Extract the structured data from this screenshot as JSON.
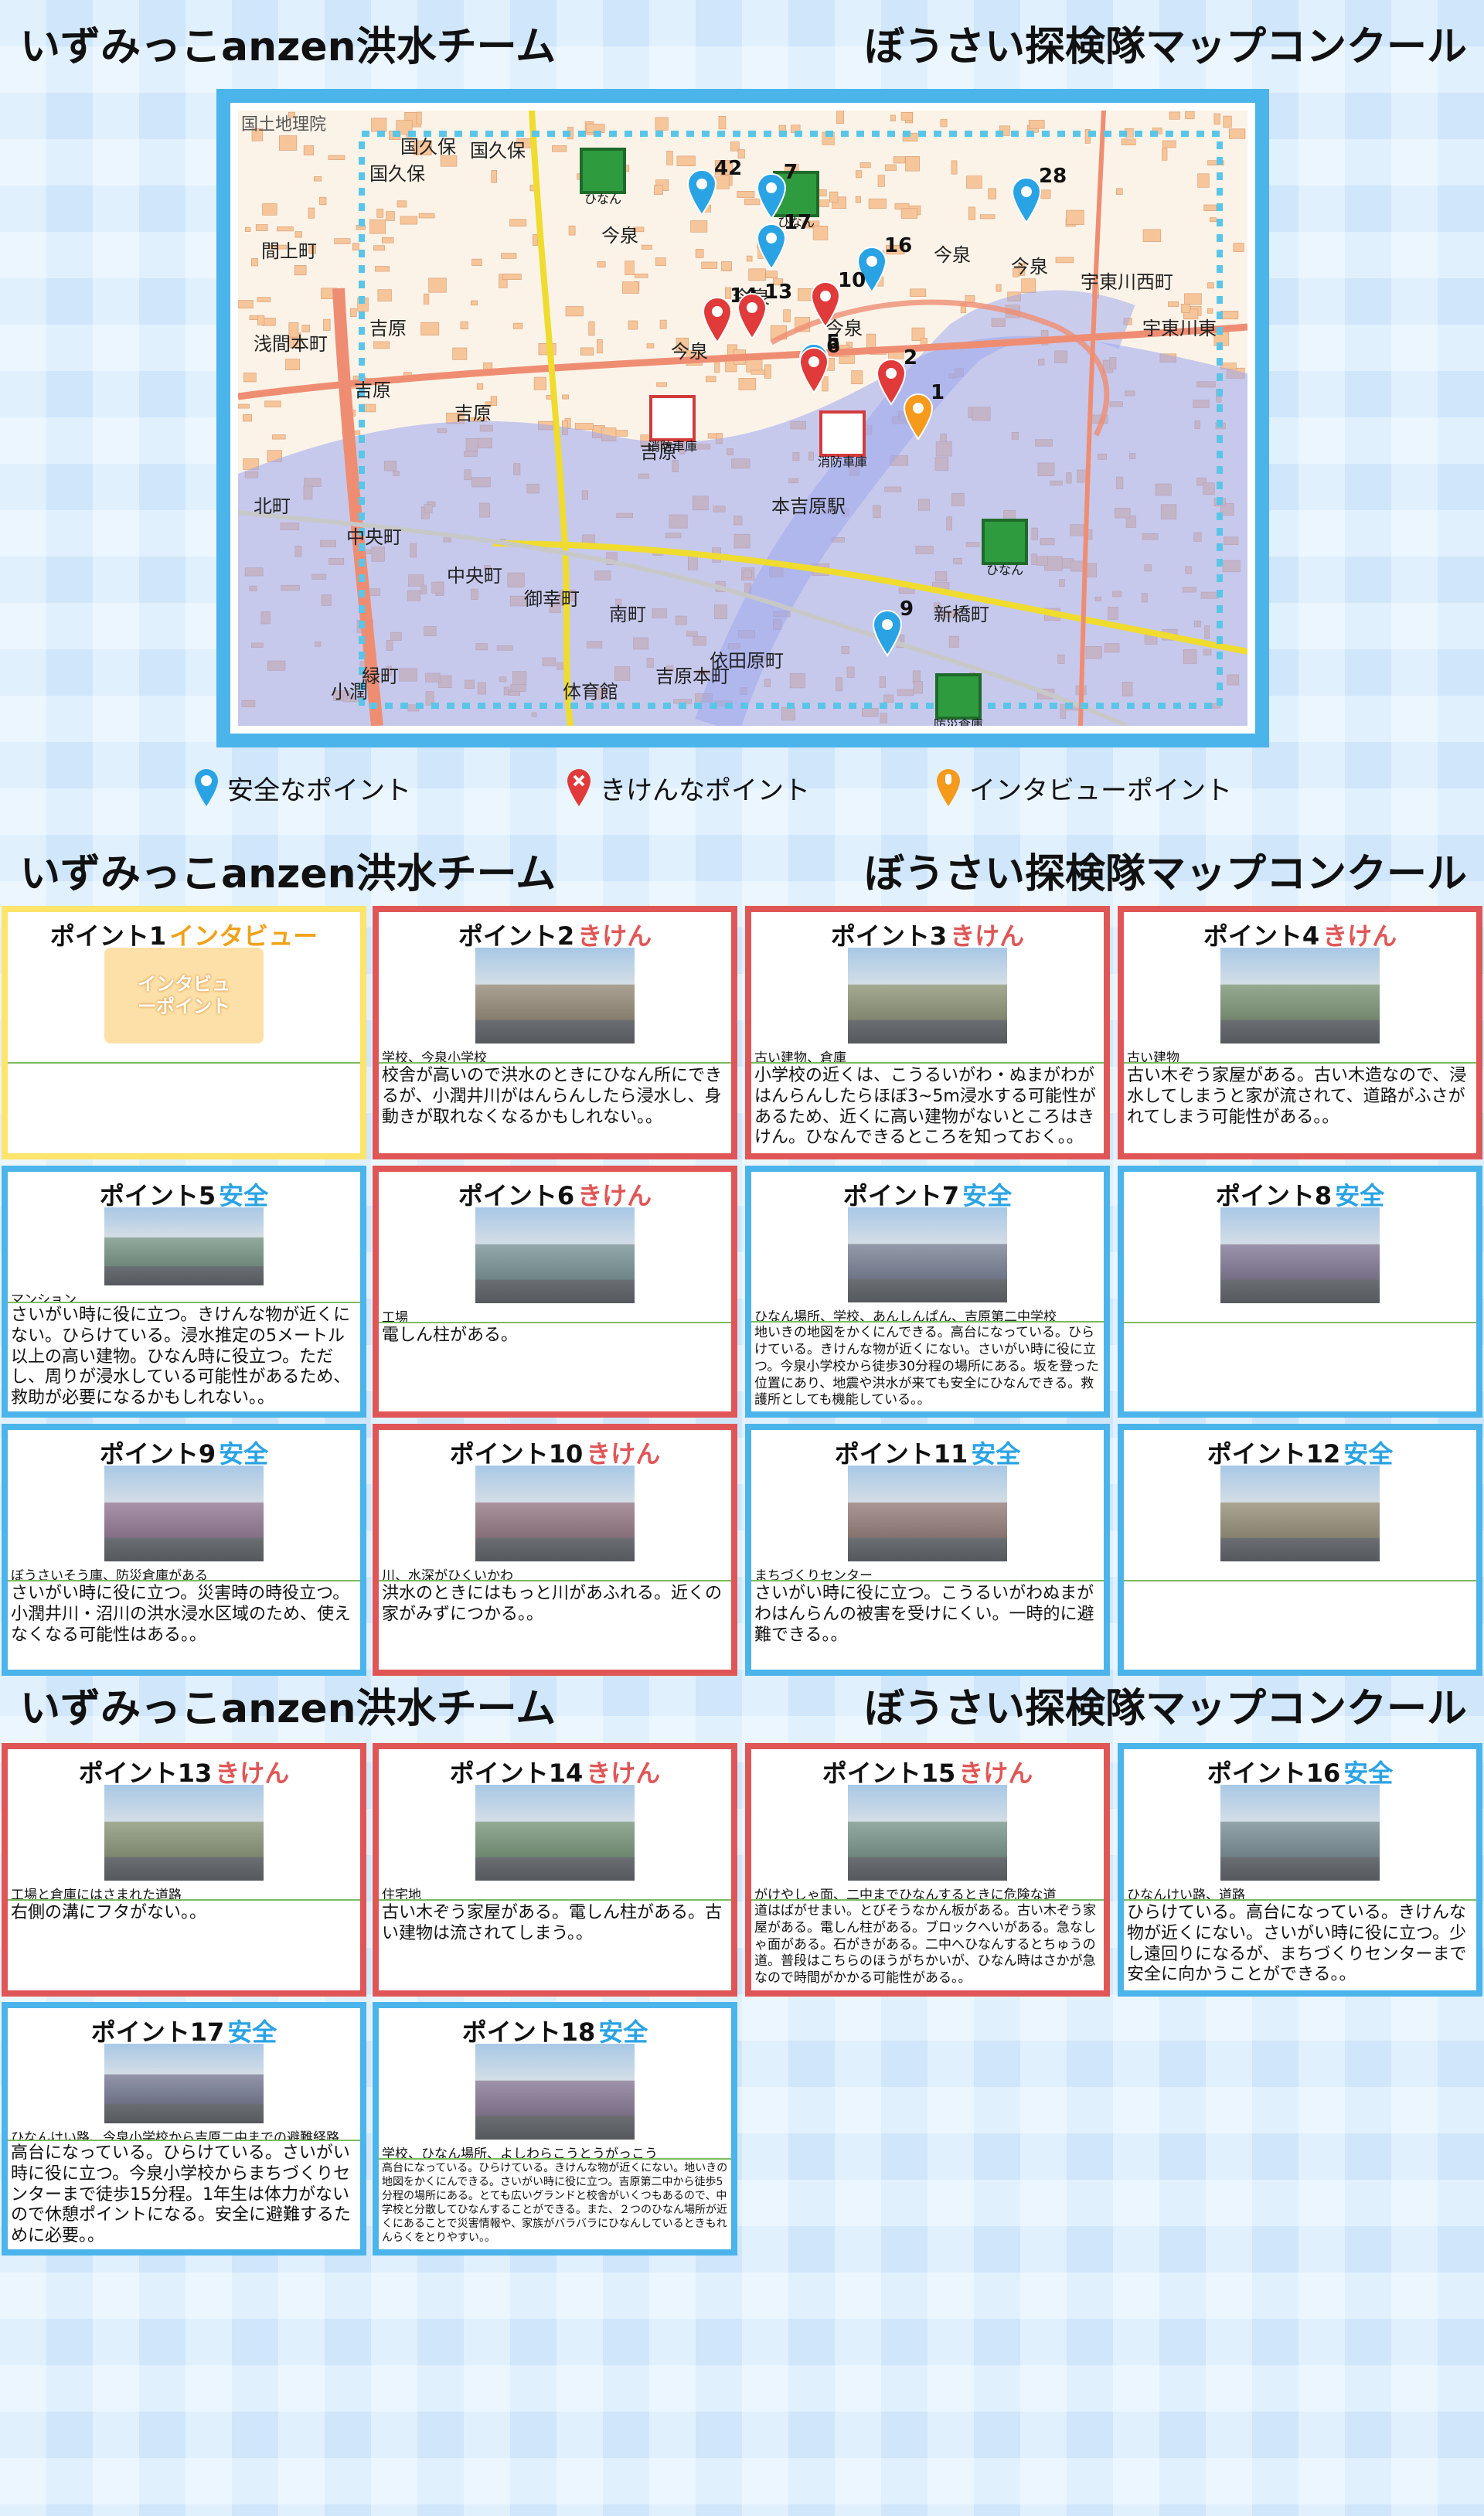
{
  "header": {
    "team": "いずみっこanzen洪水チーム",
    "contest": "ぼうさい探検隊マップコンクール"
  },
  "map": {
    "credit": "国土地理院",
    "labels": [
      "国久保",
      "国久保",
      "国久保",
      "今泉",
      "間上町",
      "浅間本町",
      "吉原",
      "吉原",
      "吉原",
      "吉原",
      "今泉",
      "今泉",
      "今泉",
      "今泉",
      "今泉",
      "宇東川西町",
      "宇東川東",
      "北町",
      "中央町",
      "中央町",
      "御幸町",
      "南町",
      "新橋町",
      "依田原町",
      "吉原本町",
      "緑町",
      "本吉原駅",
      "体育館",
      "小潤"
    ],
    "facility_labels": [
      "ひなん",
      "ひなん",
      "消防車庫",
      "消防車庫",
      "ひなん",
      "防災倉庫"
    ],
    "point_numbers": [
      "7",
      "16",
      "17",
      "14",
      "13",
      "10",
      "5",
      "2",
      "1",
      "9",
      "6",
      "42",
      "28"
    ],
    "colors": {
      "safe": "#2aa3e5",
      "danger": "#e03a3a",
      "interview": "#f59a1b",
      "flood": "#9aa6ee",
      "road_major": "#ef8d73",
      "road_yellow": "#efdc2e",
      "block": "#f6c59a"
    }
  },
  "legend": {
    "safe": "安全なポイント",
    "danger": "きけんなポイント",
    "interview": "インタビューポイント"
  },
  "points": [
    {
      "title": "ポイント1",
      "kind": "インタビュー",
      "type": "interview",
      "badge": "インタビューポイント",
      "tag": "",
      "desc": ""
    },
    {
      "title": "ポイント2",
      "kind": "きけん",
      "type": "danger",
      "tag": "学校、今泉小学校",
      "desc": "校舎が高いので洪水のときにひなん所にできるが、小潤井川がはんらんしたら浸水し、身動きが取れなくなるかもしれない。。"
    },
    {
      "title": "ポイント3",
      "kind": "きけん",
      "type": "danger",
      "tag": "古い建物、倉庫",
      "desc": "小学校の近くは、こうるいがわ・ぬまがわがはんらんしたらほぼ3~5m浸水する可能性があるため、近くに高い建物がないところはきけん。ひなんできるところを知っておく。。"
    },
    {
      "title": "ポイント4",
      "kind": "きけん",
      "type": "danger",
      "tag": "古い建物",
      "desc": "古い木ぞう家屋がある。古い木造なので、浸水してしまうと家が流されて、道路がふさがれてしまう可能性がある。。"
    },
    {
      "title": "ポイント5",
      "kind": "安全",
      "type": "safe",
      "tag": "マンション",
      "desc": "さいがい時に役に立つ。きけんな物が近くにない。ひらけている。浸水推定の5メートル以上の高い建物。ひなん時に役立つ。ただし、周りが浸水している可能性があるため、救助が必要になるかもしれない。。"
    },
    {
      "title": "ポイント6",
      "kind": "きけん",
      "type": "danger",
      "tag": "工場",
      "desc": "電しん柱がある。"
    },
    {
      "title": "ポイント7",
      "kind": "安全",
      "type": "safe",
      "tag": "ひなん場所、学校、あんしんぱん、吉原第二中学校",
      "desc": "地いきの地図をかくにんできる。高台になっている。ひらけている。きけんな物が近くにない。さいがい時に役に立つ。今泉小学校から徒歩30分程の場所にある。坂を登った位置にあり、地震や洪水が来ても安全にひなんできる。救護所としても機能している。。"
    },
    {
      "title": "ポイント8",
      "kind": "安全",
      "type": "safe",
      "tag": "",
      "desc": ""
    },
    {
      "title": "ポイント9",
      "kind": "安全",
      "type": "safe",
      "tag": "ぼうさいそう庫、防災倉庫がある",
      "desc": "さいがい時に役に立つ。災害時の時役立つ。小潤井川・沼川の洪水浸水区域のため、使えなくなる可能性はある。。"
    },
    {
      "title": "ポイント10",
      "kind": "きけん",
      "type": "danger",
      "tag": "川、水深がひくいかわ",
      "desc": "洪水のときにはもっと川があふれる。近くの家がみずにつかる。。"
    },
    {
      "title": "ポイント11",
      "kind": "安全",
      "type": "safe",
      "tag": "まちづくりセンター",
      "desc": "さいがい時に役に立つ。こうるいがわぬまがわはんらんの被害を受けにくい。一時的に避難できる。。"
    },
    {
      "title": "ポイント12",
      "kind": "安全",
      "type": "safe",
      "tag": "",
      "desc": ""
    },
    {
      "title": "ポイント13",
      "kind": "きけん",
      "type": "danger",
      "tag": "工場と倉庫にはさまれた道路",
      "desc": "右側の溝にフタがない。。"
    },
    {
      "title": "ポイント14",
      "kind": "きけん",
      "type": "danger",
      "tag": "住宅地",
      "desc": "古い木ぞう家屋がある。電しん柱がある。古い建物は流されてしまう。。"
    },
    {
      "title": "ポイント15",
      "kind": "きけん",
      "type": "danger",
      "tag": "がけやしゃ面、二中までひなんするときに危険な道",
      "desc": "道はばがせまい。とびそうなかん板がある。古い木ぞう家屋がある。電しん柱がある。ブロックへいがある。急なしゃ面がある。石がきがある。二中へひなんするとちゅうの道。普段はこちらのほうがちかいが、ひなん時はさかが急なので時間がかかる可能性がある。。"
    },
    {
      "title": "ポイント16",
      "kind": "安全",
      "type": "safe",
      "tag": "ひなんけい路、道路",
      "desc": "ひらけている。高台になっている。きけんな物が近くにない。さいがい時に役に立つ。少し遠回りになるが、まちづくりセンターまで安全に向かうことができる。。"
    },
    {
      "title": "ポイント17",
      "kind": "安全",
      "type": "safe",
      "tag": "ひなんけい路、今泉小学校から吉原二中までの避難経路",
      "desc": "高台になっている。ひらけている。さいがい時に役に立つ。今泉小学校からまちづくりセンターまで徒歩15分程。1年生は体力がないので休憩ポイントになる。安全に避難するために必要。。"
    },
    {
      "title": "ポイント18",
      "kind": "安全",
      "type": "safe",
      "tag": "学校、ひなん場所、よしわらこうとうがっこう",
      "desc": "高台になっている。ひらけている。きけんな物が近くにない。地いきの地図をかくにんできる。さいがい時に役に立つ。吉原第二中から徒歩5分程の場所にある。とても広いグランドと校舎がいくつもあるので、中学校と分散してひなんすることができる。また、２つのひなん場所が近くにあることで災害情報や、家族がバラバラにひなんしているときもれんらくをとりやすい。。"
    }
  ]
}
